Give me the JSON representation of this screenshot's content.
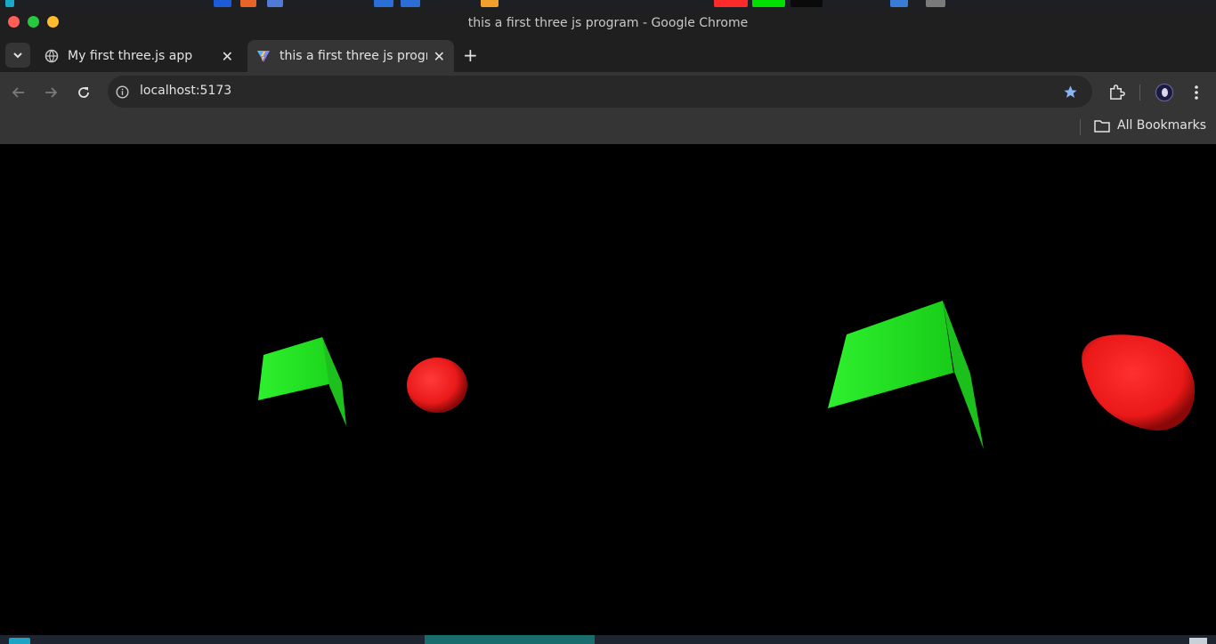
{
  "window": {
    "title": "this a first three js program - Google Chrome"
  },
  "tabs": [
    {
      "label": "My first three.js app",
      "active": false,
      "icon": "globe-icon"
    },
    {
      "label": "this a first three js progra",
      "active": true,
      "icon": "vite-logo-icon"
    }
  ],
  "toolbar": {
    "url": "localhost:5173",
    "back_icon": "arrow-left-icon",
    "forward_icon": "arrow-right-icon",
    "reload_icon": "reload-icon"
  },
  "bookmarks": {
    "all_label": "All Bookmarks"
  },
  "scene": {
    "background": "#000000",
    "plane_color": "#22e822",
    "sphere_color": "#ff2020"
  },
  "colors": {
    "titlebar": "#1f1f1f",
    "toolbar": "#353535",
    "omnibox": "#282828",
    "accent_star": "#8ab4f8"
  }
}
